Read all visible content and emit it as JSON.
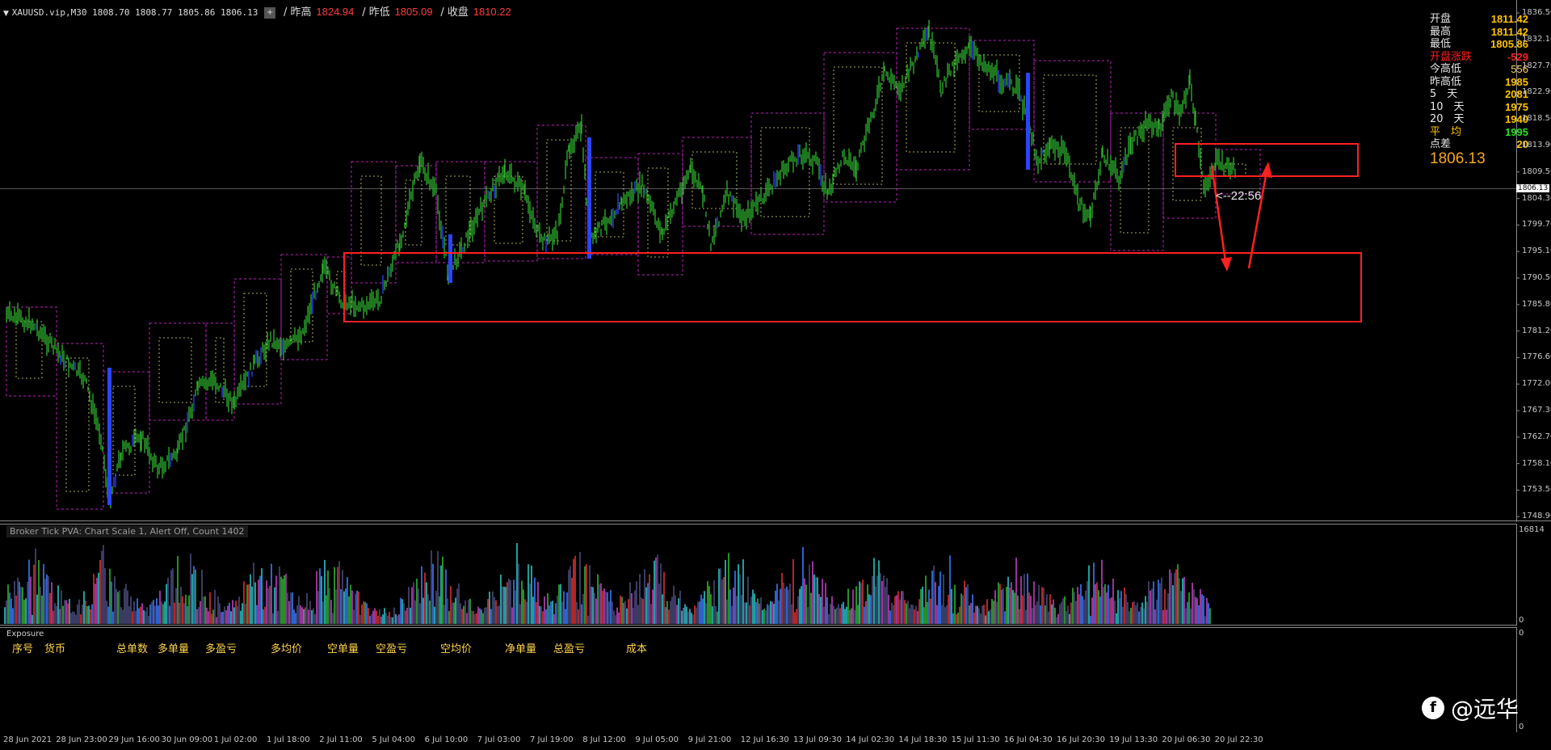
{
  "header": {
    "symbol": "XAUUSD.vip,M30  1808.70 1808.77 1805.86 1806.13",
    "btn": "+",
    "prev_high_label": "/ 昨高",
    "prev_high": "1824.94",
    "prev_low_label": "/ 昨低",
    "prev_low": "1805.09",
    "prev_close_label": "/ 收盘",
    "prev_close": "1810.22"
  },
  "stats": {
    "open_label": "开盘",
    "open": "1811.42",
    "high_label": "最高",
    "high": "1811.42",
    "low_label": "最低",
    "low": "1805.86",
    "change_label": "开盘涨跌",
    "change": "-529",
    "today_range_label": "今高低",
    "today_range": "556",
    "yest_range_label": "昨高低",
    "yest_range": "1985",
    "d5_label": "5　天",
    "d5": "2081",
    "d10_label": "10　天",
    "d10": "1975",
    "d20_label": "20　天",
    "d20": "1940",
    "avg_label": "平　均",
    "avg": "1995",
    "spread_label": "点差",
    "spread": "20",
    "current": "1806.13"
  },
  "price_axis": [
    "1836.50",
    "1832.10",
    "1827.70",
    "1822.90",
    "1818.50",
    "1813.90",
    "1809.50",
    "1804.30",
    "1799.70",
    "1795.10",
    "1790.50",
    "1785.80",
    "1781.20",
    "1776.60",
    "1772.00",
    "1767.30",
    "1762.70",
    "1758.10",
    "1753.50",
    "1748.90"
  ],
  "current_price_tag": "1806.13",
  "timer": "<--22:56",
  "volume": {
    "title": "Broker Tick  PVA:   Chart Scale  1,  Alert Off,  Count   1402",
    "max": "16814",
    "min": "0"
  },
  "exposure": {
    "title": "Exposure",
    "columns": [
      "序号",
      "货币",
      "总单数",
      "多单量",
      "多盈亏",
      "多均价",
      "空单量",
      "空盈亏",
      "空均价",
      "净单量",
      "总盈亏",
      "成本"
    ],
    "axis_top": "0",
    "axis_bottom": "0"
  },
  "time_axis": [
    "28 Jun 2021",
    "28 Jun 23:00",
    "29 Jun 16:00",
    "30 Jun 09:00",
    "1 Jul 02:00",
    "1 Jul 18:00",
    "2 Jul 11:00",
    "5 Jul 04:00",
    "6 Jul 10:00",
    "7 Jul 03:00",
    "7 Jul 19:00",
    "8 Jul 12:00",
    "9 Jul 05:00",
    "9 Jul 21:00",
    "12 Jul 16:30",
    "13 Jul 09:30",
    "14 Jul 02:30",
    "14 Jul 18:30",
    "15 Jul 11:30",
    "16 Jul 04:30",
    "16 Jul 20:30",
    "19 Jul 13:30",
    "20 Jul 06:30",
    "20 Jul 22:30"
  ],
  "watermark": "@远华",
  "colors": {
    "bull": "#2fb52f",
    "bear": "#2a45ff",
    "annotation": "#ff2020",
    "box_magenta": "#c020c0",
    "box_yellow": "#e0e070"
  }
}
